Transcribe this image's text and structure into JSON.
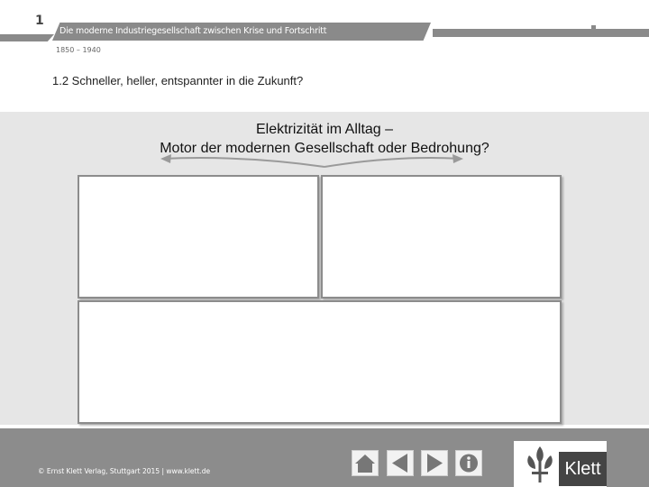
{
  "header": {
    "chapter_number": "1",
    "chapter_title": "Die moderne Industriegesellschaft zwischen Krise und Fortschritt",
    "years": "1850 – 1940",
    "section_heading": "1.2  Schneller, heller, entspannter in die Zukunft?"
  },
  "main": {
    "title_line1": "Elektrizität im Alltag –",
    "title_line2": "Motor der modernen Gesellschaft oder Bedrohung?"
  },
  "footer": {
    "copyright": "© Ernst Klett Verlag, Stuttgart 2015 | www.klett.de",
    "nav": [
      "home-icon",
      "arrow-left-icon",
      "arrow-right-icon",
      "info-icon"
    ],
    "logo_text": "Klett"
  },
  "colors": {
    "band": "#8a8a8a",
    "content_bg": "#e6e6e6",
    "footer_bg": "#8c8c8c",
    "box_border": "#8c8c8c"
  }
}
